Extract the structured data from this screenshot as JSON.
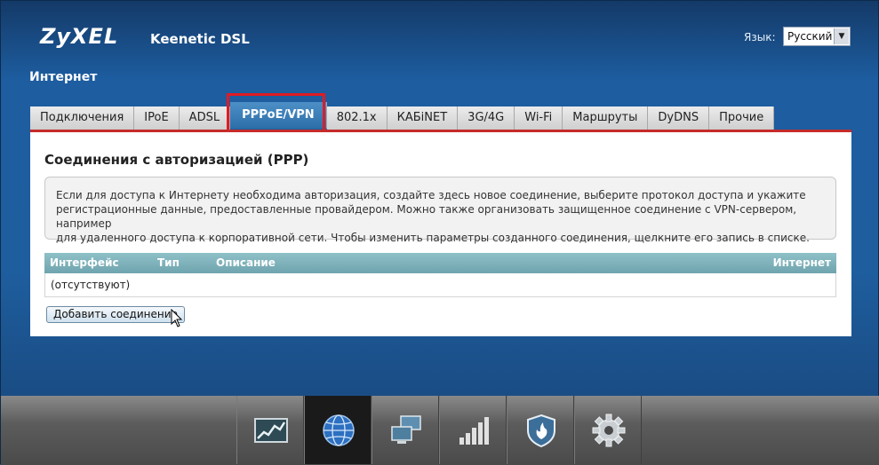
{
  "header": {
    "logo": "ZyXEL",
    "model": "Keenetic DSL",
    "language_label": "Язык:",
    "language_selected": "Русский"
  },
  "page": {
    "section_title": "Интернет"
  },
  "tabs": [
    {
      "label": "Подключения",
      "active": false
    },
    {
      "label": "IPoE",
      "active": false
    },
    {
      "label": "ADSL",
      "active": false
    },
    {
      "label": "PPPoE/VPN",
      "active": true
    },
    {
      "label": "802.1x",
      "active": false
    },
    {
      "label": "КАБiNET",
      "active": false
    },
    {
      "label": "3G/4G",
      "active": false
    },
    {
      "label": "Wi-Fi",
      "active": false
    },
    {
      "label": "Маршруты",
      "active": false
    },
    {
      "label": "DyDNS",
      "active": false
    },
    {
      "label": "Прочие",
      "active": false
    }
  ],
  "panel": {
    "title": "Соединения с авторизацией (PPP)",
    "info_line1": "Если для доступа к Интернету необходима авторизация, создайте здесь новое соединение, выберите протокол доступа и укажите",
    "info_line2": "регистрационные данные, предоставленные провайдером. Можно также организовать защищенное соединение с VPN-сервером, например",
    "info_line3": "для удаленного доступа к корпоративной сети. Чтобы изменить параметры созданного соединения, щелкните его запись в списке.",
    "table": {
      "columns": [
        "Интерфейс",
        "Тип",
        "Описание",
        "Интернет"
      ],
      "empty_text": "(отсутствуют)"
    },
    "add_button": "Добавить соединение"
  },
  "dock": [
    {
      "icon": "chart-icon",
      "active": false
    },
    {
      "icon": "globe-icon",
      "active": true
    },
    {
      "icon": "network-computers-icon",
      "active": false
    },
    {
      "icon": "signal-bars-icon",
      "active": false
    },
    {
      "icon": "shield-icon",
      "active": false
    },
    {
      "icon": "gear-icon",
      "active": false
    }
  ]
}
